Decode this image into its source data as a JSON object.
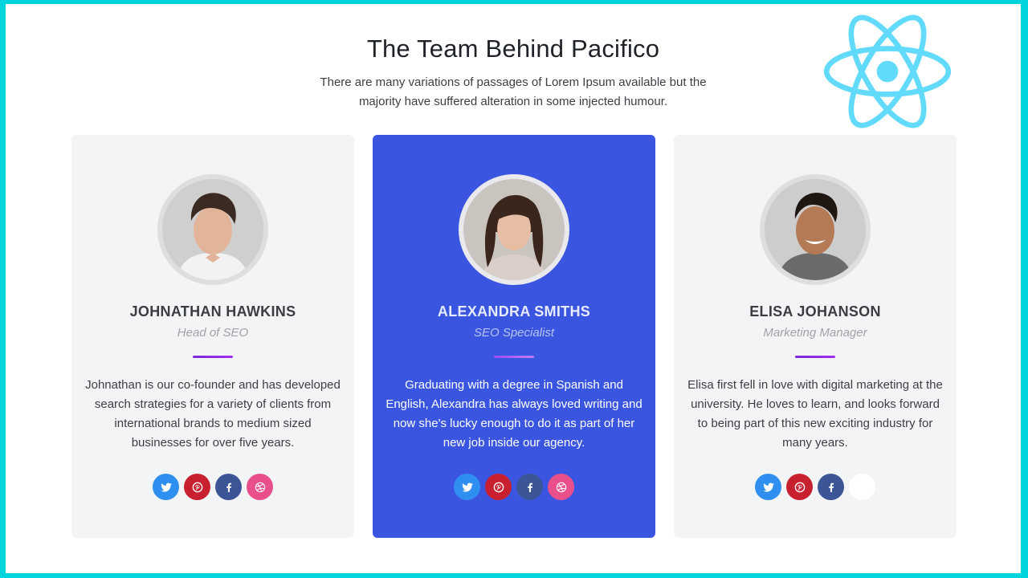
{
  "header": {
    "title": "The Team Behind Pacifico",
    "subtitle": "There are many variations of passages of Lorem Ipsum available but the majority have suffered alteration in some injected humour."
  },
  "brand": {
    "logo_icon": "react-logo-icon",
    "logo_color": "#61dafb",
    "accent": "#3a56e0",
    "frame_color": "#00d4dc"
  },
  "team": [
    {
      "name": "JOHNATHAN HAWKINS",
      "role": "Head of SEO",
      "bio": "Johnathan is our co-founder and has developed search strategies for a variety of clients from international brands to medium sized businesses for over five years.",
      "socials": [
        "twitter-icon",
        "pinterest-icon",
        "facebook-icon",
        "dribbble-icon"
      ]
    },
    {
      "name": "ALEXANDRA SMITHS",
      "role": "SEO Specialist",
      "bio": "Graduating with a degree in Spanish and English, Alexandra has always loved writing and now she's lucky enough to do it as part of her new job inside our agency.",
      "socials": [
        "twitter-icon",
        "pinterest-icon",
        "facebook-icon",
        "dribbble-icon"
      ]
    },
    {
      "name": "ELISA JOHANSON",
      "role": "Marketing Manager",
      "bio": "Elisa first fell in love with digital marketing at the university. He loves to learn, and looks forward to being part of this new exciting industry for many years.",
      "socials": [
        "twitter-icon",
        "pinterest-icon",
        "facebook-icon",
        "blank"
      ]
    }
  ]
}
